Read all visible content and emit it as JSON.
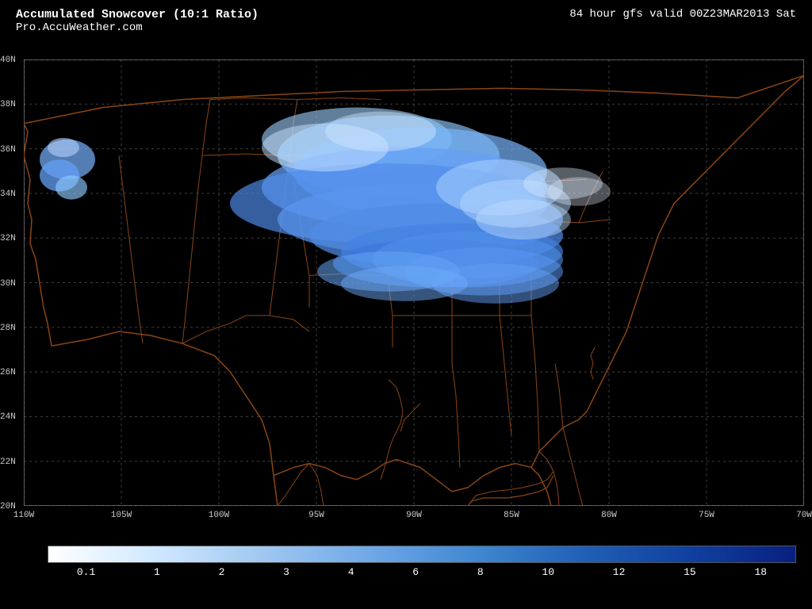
{
  "header": {
    "title": "Accumulated Snowcover (10:1 Ratio)",
    "subtitle": "Pro.AccuWeather.com",
    "forecast_info": "84 hour gfs valid   00Z23MAR2013   Sat"
  },
  "map": {
    "lat_labels": [
      "40N",
      "38N",
      "36N",
      "34N",
      "32N",
      "30N",
      "28N",
      "26N",
      "24N",
      "22N",
      "20N"
    ],
    "lon_labels": [
      "110W",
      "105W",
      "100W",
      "95W",
      "90W",
      "85W",
      "80W",
      "75W",
      "70W"
    ]
  },
  "scale": {
    "values": [
      "0.1",
      "1",
      "2",
      "3",
      "4",
      "6",
      "8",
      "10",
      "12",
      "15",
      "18"
    ]
  }
}
